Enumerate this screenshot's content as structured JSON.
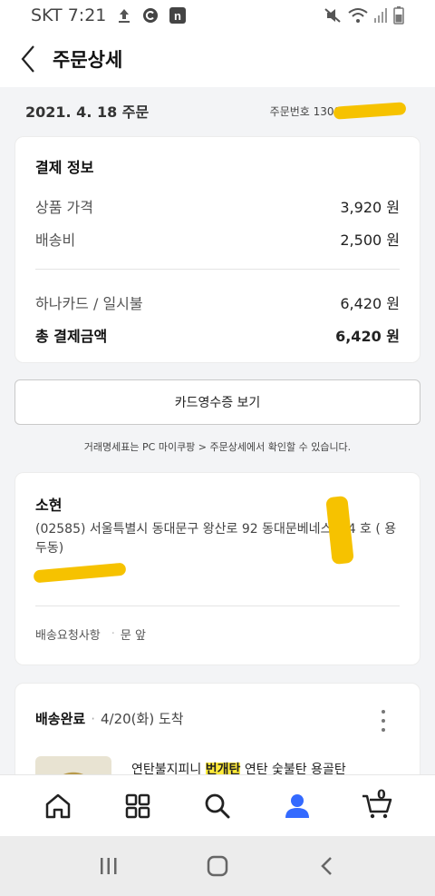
{
  "status_bar": {
    "carrier": "SKT",
    "time": "7:21",
    "n_icon_letter": "n"
  },
  "header": {
    "title": "주문상세"
  },
  "order": {
    "date_label": "2021. 4. 18 주문",
    "order_number_label": "주문번호 1300"
  },
  "payment": {
    "heading": "결제 정보",
    "rows": [
      {
        "label": "상품 가격",
        "value": "3,920 원"
      },
      {
        "label": "배송비",
        "value": "2,500 원"
      },
      {
        "label": "하나카드 / 일시불",
        "value": "6,420 원"
      }
    ],
    "total": {
      "label": "총 결제금액",
      "value": "6,420 원"
    }
  },
  "receipt_button": "카드영수증 보기",
  "notice": "거래명세표는 PC 마이쿠팡 > 주문상세에서 확인할 수 있습니다.",
  "address": {
    "name": "소현",
    "line": "(02585) 서울특별시 동대문구 왕산로 92 동대문베네스트 4 호 ( 용두동)",
    "request_label": "배송요청사항",
    "request_value": "문 앞"
  },
  "shipment": {
    "status": "배송완료",
    "arrival": "4/20(화) 도착",
    "product_before": "연탄불지피니 ",
    "product_highlight": "번개탄",
    "product_after": " 연탄 숯불탄 용골탄"
  },
  "bottom_nav": {
    "cart_count": "0"
  },
  "colors": {
    "accent": "#346aff",
    "redaction": "#f6c200",
    "highlight": "#ffeb3b"
  },
  "icons": [
    "upload-icon",
    "c-badge-icon",
    "n-app-icon",
    "mute-icon",
    "wifi-icon",
    "signal-icon",
    "battery-icon",
    "back-icon",
    "more-icon",
    "home-icon",
    "category-icon",
    "search-icon",
    "profile-icon",
    "cart-icon",
    "recents-icon",
    "sys-home-icon",
    "sys-back-icon"
  ]
}
